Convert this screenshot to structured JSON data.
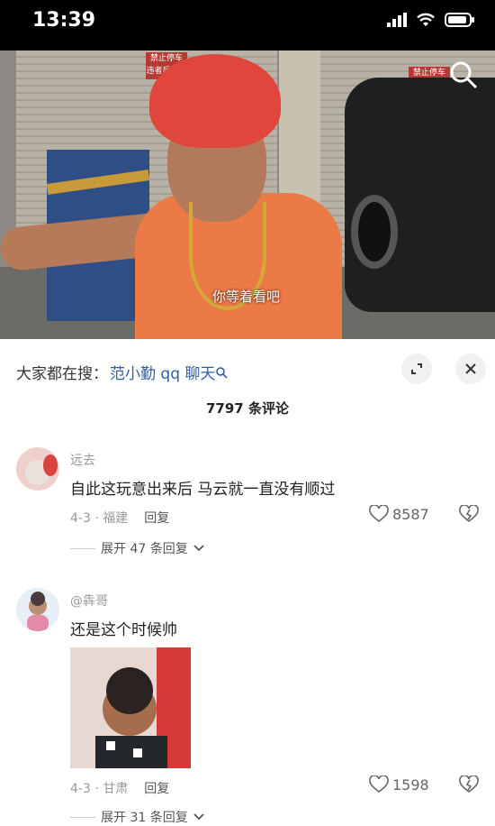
{
  "status": {
    "time": "13:39"
  },
  "video": {
    "subtitle": "你等着看吧",
    "sign_left": "禁止停车 违者后果自负",
    "sign_right": "禁止停车"
  },
  "search_hint": {
    "prefix": "大家都在搜：",
    "keyword": "范小勤 qq 聊天"
  },
  "comment_count": "7797 条评论",
  "comments": [
    {
      "user": "远去",
      "text": "自此这玩意出来后 马云就一直没有顺过",
      "date": "4-3 · 福建",
      "reply": "回复",
      "likes": "8587",
      "expand": "展开 47 条回复"
    },
    {
      "user": "@犇哥",
      "text": "还是这个时候帅",
      "date": "4-3 · 甘肃",
      "reply": "回复",
      "likes": "1598",
      "expand": "展开 31 条回复"
    }
  ],
  "colors": {
    "accent": "#2f5fa7",
    "hair": "#e0463c",
    "shirt": "#ec7a46"
  },
  "icons": [
    "signal-icon",
    "wifi-icon",
    "battery-icon",
    "search-icon",
    "expand-icon",
    "close-icon",
    "heart-icon",
    "dislike-icon",
    "chevron-down-icon"
  ]
}
